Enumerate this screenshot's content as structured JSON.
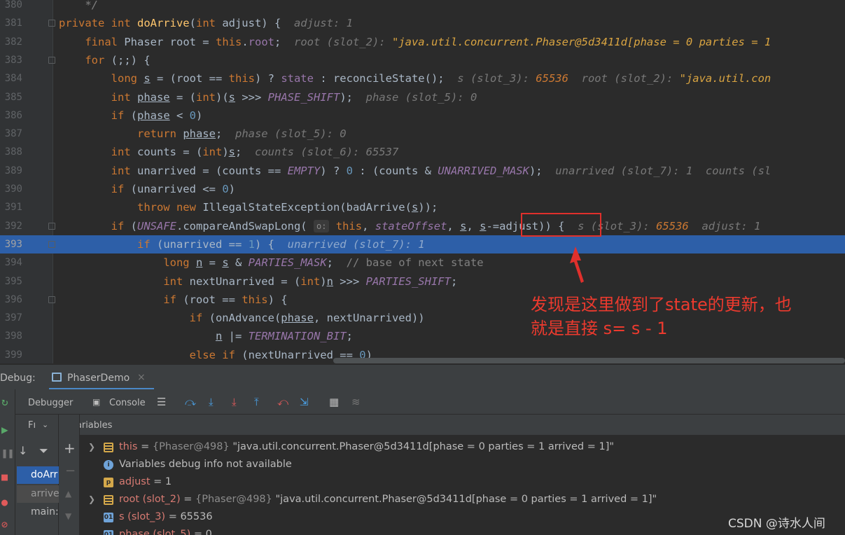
{
  "editor": {
    "lines": [
      {
        "num": "380",
        "fold": false,
        "current": false,
        "html": "    <span class='c'>*/</span>"
      },
      {
        "num": "381",
        "fold": true,
        "current": false,
        "html": "<span class='k'>private int </span><span class='f'>doArrive</span>(<span class='k'>int </span>adjust) {  <span class='h'>adjust: 1</span>"
      },
      {
        "num": "382",
        "fold": false,
        "current": false,
        "html": "    <span class='k'>final </span>Phaser root = <span class='k'>this</span>.<span style='color:#9876aa'>root</span>;  <span class='h'>root (slot_2): </span><span class='hs'>\"java.util.concurrent.Phaser@5d3411d[phase = 0 parties = 1</span>"
      },
      {
        "num": "383",
        "fold": true,
        "current": false,
        "html": "    <span class='k'>for </span>(;;) {"
      },
      {
        "num": "384",
        "fold": false,
        "current": false,
        "html": "        <span class='k'>long </span><span class='u'>s</span> = (root == <span class='k'>this</span>) ? <span style='color:#9876aa'>state</span> : reconcileState();  <span class='h'>s (slot_3): </span><span class='hv'>65536</span>  <span class='h'>root (slot_2): </span><span class='hs'>\"java.util.con</span>"
      },
      {
        "num": "385",
        "fold": false,
        "current": false,
        "html": "        <span class='k'>int </span><span class='u'>phase</span> = (<span class='k'>int</span>)(<span class='u'>s</span> >>> <span class='st'>PHASE_SHIFT</span>);  <span class='h'>phase (slot_5): 0</span>"
      },
      {
        "num": "386",
        "fold": false,
        "current": false,
        "html": "        <span class='k'>if </span>(<span class='u'>phase</span> < <span class='n'>0</span>)"
      },
      {
        "num": "387",
        "fold": false,
        "current": false,
        "html": "            <span class='k'>return </span><span class='u'>phase</span>;  <span class='h'>phase (slot_5): 0</span>"
      },
      {
        "num": "388",
        "fold": false,
        "current": false,
        "html": "        <span class='k'>int </span>counts = (<span class='k'>int</span>)<span class='u'>s</span>;  <span class='h'>counts (slot_6): 65537</span>"
      },
      {
        "num": "389",
        "fold": false,
        "current": false,
        "html": "        <span class='k'>int </span>unarrived = (counts == <span class='st'>EMPTY</span>) ? <span class='n'>0</span> : (counts &amp; <span class='st'>UNARRIVED_MASK</span>);  <span class='h'>unarrived (slot_7): 1  counts (sl</span>"
      },
      {
        "num": "390",
        "fold": false,
        "current": false,
        "html": "        <span class='k'>if </span>(unarrived <= <span class='n'>0</span>)"
      },
      {
        "num": "391",
        "fold": false,
        "current": false,
        "html": "            <span class='k'>throw new </span>IllegalStateException(badArrive(<span class='u'>s</span>));"
      },
      {
        "num": "392",
        "fold": true,
        "current": false,
        "html": "        <span class='k'>if </span>(<span class='st'>UNSAFE</span>.compareAndSwapLong( <span class='hint'>o:</span> <span class='k'>this</span>, <span class='st'>stateOffset</span>, <span class='u'>s</span>, <span class='u'>s</span>-=adjust)) {  <span class='h'>s (slot_3): </span><span class='hv'>65536</span>  <span class='h'>adjust: 1</span>"
      },
      {
        "num": "393",
        "fold": true,
        "current": true,
        "html": "            <span class='k'>if </span>(unarrived == <span class='n'>1</span>) {  <span class='h' style='color:#8fa9cc'>unarrived (slot_7): 1</span>"
      },
      {
        "num": "394",
        "fold": false,
        "current": false,
        "html": "                <span class='k'>long </span><span class='u'>n</span> = <span class='u'>s</span> &amp; <span class='st'>PARTIES_MASK</span>;  <span style='color:#808080'>// base of next state</span>"
      },
      {
        "num": "395",
        "fold": false,
        "current": false,
        "html": "                <span class='k'>int </span>nextUnarrived = (<span class='k'>int</span>)<span class='u'>n</span> >>> <span class='st'>PARTIES_SHIFT</span>;"
      },
      {
        "num": "396",
        "fold": true,
        "current": false,
        "html": "                <span class='k'>if </span>(root == <span class='k'>this</span>) {"
      },
      {
        "num": "397",
        "fold": false,
        "current": false,
        "html": "                    <span class='k'>if </span>(onAdvance(<span class='u'>phase</span>, nextUnarrived))"
      },
      {
        "num": "398",
        "fold": false,
        "current": false,
        "html": "                        <span class='u'>n</span> |= <span class='st'>TERMINATION_BIT</span>;"
      },
      {
        "num": "399",
        "fold": false,
        "current": false,
        "html": "                    <span class='k'>else if </span>(nextUnarrived == <span class='n'>0</span>)"
      }
    ]
  },
  "annotation": {
    "line1": "发现是这里做到了state的更新，也",
    "line2": "就是直接 s= s - 1"
  },
  "debug": {
    "label": "Debug:",
    "session": "PhaserDemo",
    "tab_debugger": "Debugger",
    "tab_console": "Console",
    "frames_label": "Fı",
    "variables_label": "Variables",
    "frames": [
      "doArr",
      "arrive",
      "main:"
    ]
  },
  "variables": [
    {
      "expand": true,
      "icon": "field-icon",
      "icon_color": "#d4a84a",
      "icon_char": "",
      "name": "this",
      "rest": " = ",
      "gray": "{Phaser@498}",
      "value": " \"java.util.concurrent.Phaser@5d3411d[phase = 0 parties = 1 arrived = 1]\""
    },
    {
      "expand": false,
      "icon": "info-icon",
      "icon_color": "#6fa3d8",
      "icon_char": "i",
      "name": "",
      "rest": "Variables debug info not available",
      "gray": "",
      "value": ""
    },
    {
      "expand": false,
      "icon": "param-icon",
      "icon_color": "#d4a84a",
      "icon_char": "p",
      "name": "adjust",
      "rest": " = 1",
      "gray": "",
      "value": ""
    },
    {
      "expand": true,
      "icon": "field-icon",
      "icon_color": "#d4a84a",
      "icon_char": "",
      "name": "root (slot_2)",
      "rest": " = ",
      "gray": "{Phaser@498}",
      "value": " \"java.util.concurrent.Phaser@5d3411d[phase = 0 parties = 1 arrived = 1]\""
    },
    {
      "expand": false,
      "icon": "primitive-icon",
      "icon_color": "#6fa3d8",
      "icon_char": "01",
      "name": "s (slot_3)",
      "rest": " = 65536",
      "gray": "",
      "value": ""
    },
    {
      "expand": false,
      "icon": "primitive-icon",
      "icon_color": "#6fa3d8",
      "icon_char": "01",
      "name": "phase (slot_5)",
      "rest": " = 0",
      "gray": "",
      "value": ""
    }
  ],
  "watermark": "CSDN @诗水人间"
}
